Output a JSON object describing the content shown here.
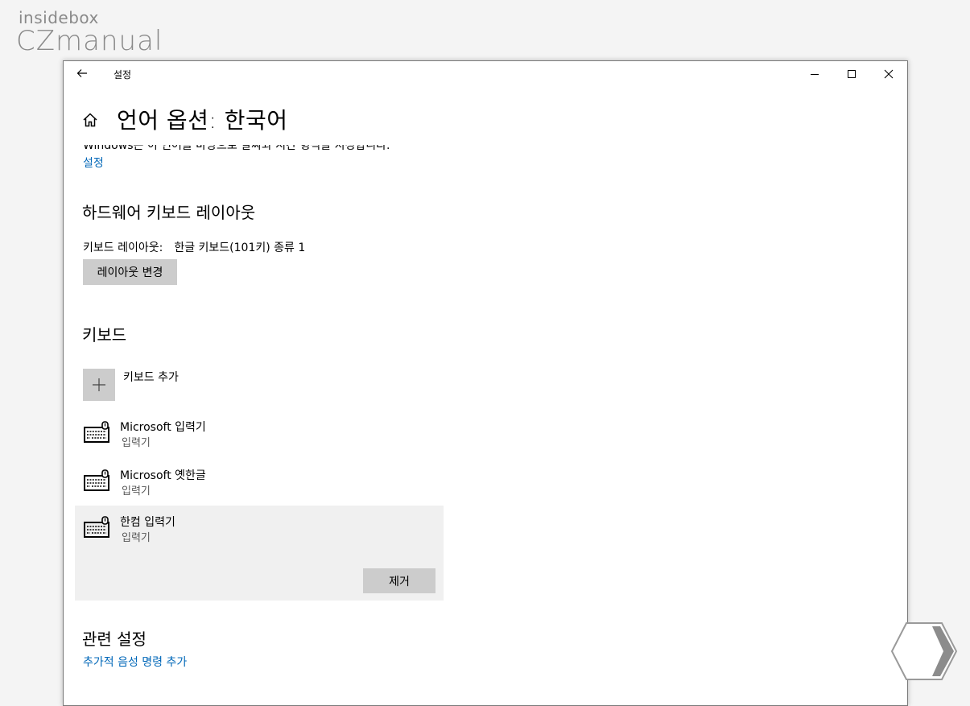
{
  "watermark": {
    "line1": "insidebox",
    "line2": "CZmanual"
  },
  "window": {
    "title": "설정",
    "back_icon": "arrow-left-icon",
    "controls": [
      "minimize-icon",
      "maximize-icon",
      "close-icon"
    ]
  },
  "page": {
    "title": "언어 옵션: 한국어",
    "cut_text": "Windows는 이 언어를 바탕으로 날짜와 시간 형식을 지정합니다.",
    "settings_link": "설정"
  },
  "hardware_keyboard": {
    "title": "하드웨어 키보드 레이아웃",
    "layout_label": "키보드 레이아웃:",
    "layout_value": "한글 키보드(101키) 종류 1",
    "change_button": "레이아웃 변경"
  },
  "keyboards": {
    "title": "키보드",
    "add_label": "키보드 추가",
    "items": [
      {
        "name": "Microsoft 입력기",
        "type": "입력기"
      },
      {
        "name": "Microsoft 옛한글",
        "type": "입력기"
      },
      {
        "name": "한컴 입력기",
        "type": "입력기",
        "selected": true
      }
    ],
    "remove_button": "제거"
  },
  "related": {
    "title": "관련 설정",
    "voice_link": "추가적 음성 명령 추가"
  },
  "colors": {
    "link": "#0067b8",
    "button": "#cccccc",
    "selected_row": "#f0f0f0"
  }
}
